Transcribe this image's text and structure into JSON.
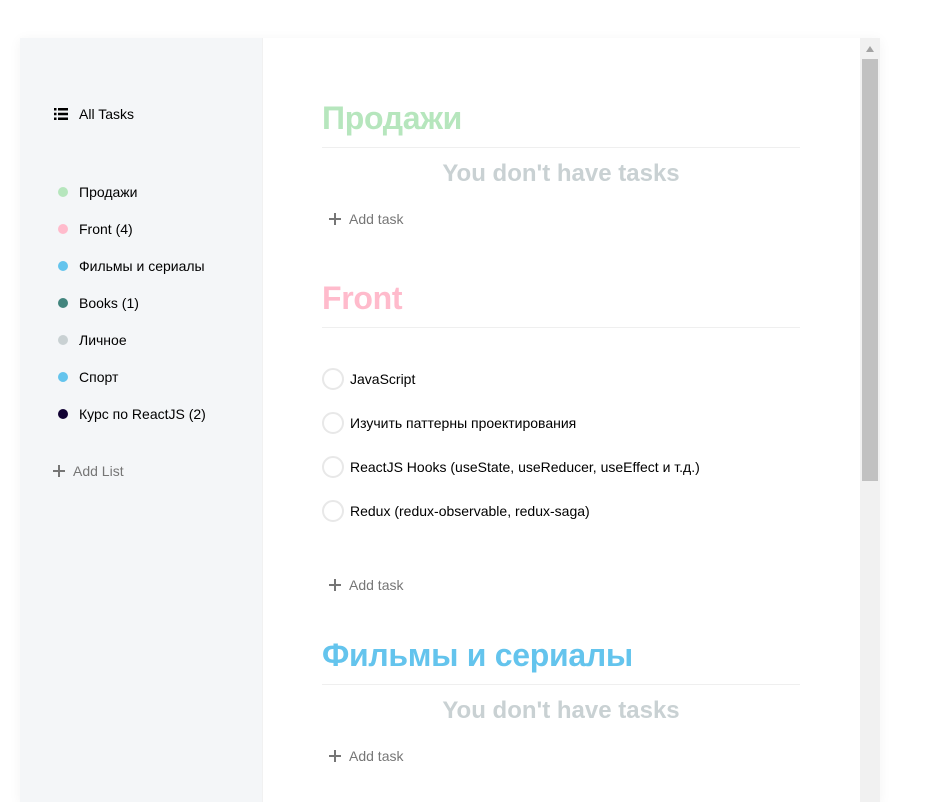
{
  "sidebar": {
    "all_tasks_label": "All Tasks",
    "lists": [
      {
        "label": "Продажи",
        "color": "#b6e6bd"
      },
      {
        "label": "Front (4)",
        "color": "#ffbbcc"
      },
      {
        "label": "Фильмы и сериалы",
        "color": "#64c4ed"
      },
      {
        "label": "Books (1)",
        "color": "#42857e"
      },
      {
        "label": "Личное",
        "color": "#c9d1d3"
      },
      {
        "label": "Спорт",
        "color": "#64c4ed"
      },
      {
        "label": "Курс по ReactJS (2)",
        "color": "#110133"
      }
    ],
    "add_list_label": "Add List"
  },
  "main": {
    "sections": [
      {
        "title": "Продажи",
        "color": "#b6e6bd",
        "empty_text": "You don't have tasks",
        "add_task_label": "Add task"
      },
      {
        "title": "Front",
        "color": "#ffbbcc",
        "tasks": [
          "JavaScript",
          "Изучить паттерны проектирования",
          "ReactJS Hooks (useState, useReducer, useEffect и т.д.)",
          "Redux (redux-observable, redux-saga)"
        ],
        "add_task_label": "Add task"
      },
      {
        "title": "Фильмы и сериалы",
        "color": "#64c4ed",
        "empty_text": "You don't have tasks",
        "add_task_label": "Add task"
      }
    ]
  },
  "icons": {
    "all_tasks": "list-icon",
    "add": "plus-icon",
    "checkbox": "circle-checkbox-icon"
  }
}
